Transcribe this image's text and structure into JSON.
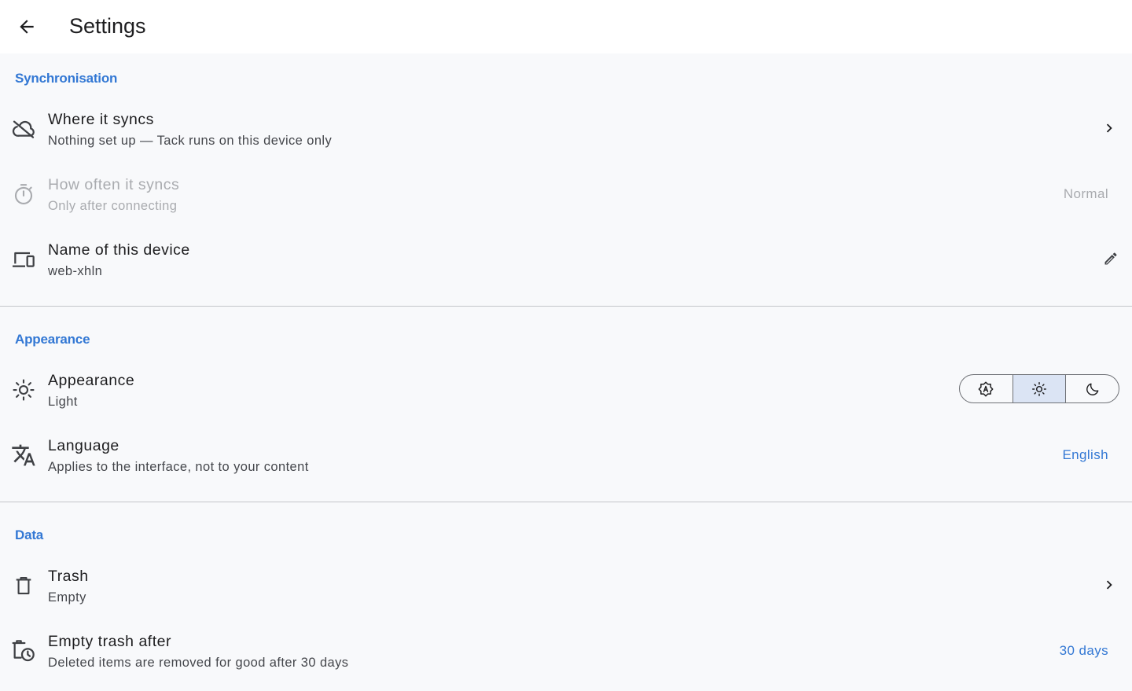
{
  "header": {
    "title": "Settings",
    "back_icon": "arrow-left-icon"
  },
  "sections": {
    "sync": {
      "header": "Synchronisation",
      "where": {
        "title": "Where it syncs",
        "subtitle": "Nothing set up — Tack runs on this device only",
        "icon": "cloud-off-icon",
        "trailing_icon": "chevron-right-icon"
      },
      "how_often": {
        "title": "How often it syncs",
        "subtitle": "Only after connecting",
        "icon": "timer-icon",
        "value": "Normal",
        "disabled": true
      },
      "device_name": {
        "title": "Name of this device",
        "subtitle": "web-xhln",
        "icon": "devices-icon",
        "trailing_icon": "pencil-icon"
      }
    },
    "appearance": {
      "header": "Appearance",
      "theme": {
        "title": "Appearance",
        "subtitle": "Light",
        "icon": "sun-icon",
        "options": [
          "auto",
          "light",
          "dark"
        ],
        "selected": "light"
      },
      "language": {
        "title": "Language",
        "subtitle": "Applies to the interface, not to your content",
        "icon": "translate-icon",
        "value": "English"
      }
    },
    "data": {
      "header": "Data",
      "trash": {
        "title": "Trash",
        "subtitle": "Empty",
        "icon": "trash-icon",
        "trailing_icon": "chevron-right-icon"
      },
      "empty_after": {
        "title": "Empty trash after",
        "subtitle": "Deleted items are removed for good after 30 days",
        "icon": "delete-clock-icon",
        "value": "30 days"
      }
    }
  },
  "colors": {
    "accent": "#3378d4",
    "background": "#f8f9fb",
    "topbar": "#ffffff",
    "divider": "#c4c6ca",
    "disabled_text": "#a9abaf",
    "segment_selected": "#dbe4f4"
  }
}
